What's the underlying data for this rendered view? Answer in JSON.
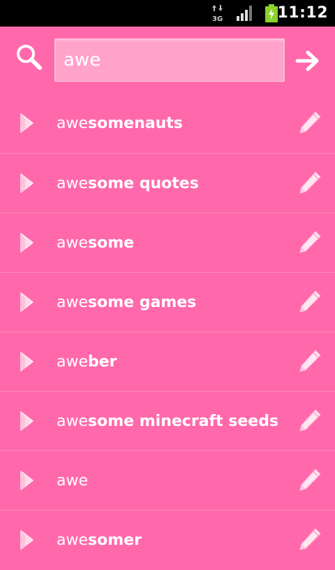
{
  "status_bar": {
    "network": "3G",
    "time": "11:12"
  },
  "search": {
    "value": "awe",
    "icon": "search-icon",
    "go_icon": "arrow-right-icon"
  },
  "suggestions": [
    {
      "prefix": "awe",
      "suffix": "somenauts"
    },
    {
      "prefix": "awe",
      "suffix": "some quotes"
    },
    {
      "prefix": "awe",
      "suffix": "some"
    },
    {
      "prefix": "awe",
      "suffix": "some games"
    },
    {
      "prefix": "awe",
      "suffix": "ber"
    },
    {
      "prefix": "awe",
      "suffix": "some minecraft seeds"
    },
    {
      "prefix": "awe",
      "suffix": ""
    },
    {
      "prefix": "awe",
      "suffix": "somer"
    }
  ],
  "colors": {
    "background": "#ff69ab",
    "input_background": "#ffa3cb",
    "divider": "#ff86bb"
  }
}
